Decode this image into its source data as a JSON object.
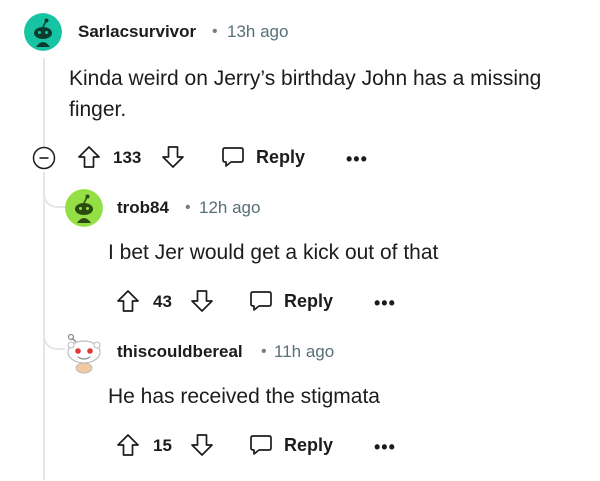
{
  "comments": [
    {
      "username": "Sarlacsurvivor",
      "separator": "•",
      "timestamp": "13h ago",
      "body": "Kinda weird on Jerry’s birthday John has a missing finger.",
      "score": "133",
      "reply_label": "Reply",
      "more_label": "•••",
      "avatar": "snoo-avatar-green",
      "avatar_color": "#16c4a3"
    },
    {
      "username": "trob84",
      "separator": "•",
      "timestamp": "12h ago",
      "body": "I bet Jer would get a kick out of that",
      "score": "43",
      "reply_label": "Reply",
      "more_label": "•••",
      "avatar": "snoo-avatar-lightgreen",
      "avatar_color": "#94e044"
    },
    {
      "username": "thiscouldbereal",
      "separator": "•",
      "timestamp": "11h ago",
      "body": "He has received the stigmata",
      "score": "15",
      "reply_label": "Reply",
      "more_label": "•••",
      "avatar": "snoo-avatar-custom",
      "avatar_color": "#f2f2f2"
    }
  ],
  "icons": {
    "collapse": "collapse-minus-icon",
    "upvote": "upvote-arrow-icon",
    "downvote": "downvote-arrow-icon",
    "reply": "speech-bubble-icon",
    "more": "more-options-icon"
  },
  "colors": {
    "text": "#1c1c1c",
    "meta": "#576f76",
    "thread_line": "#e4e6e8"
  }
}
